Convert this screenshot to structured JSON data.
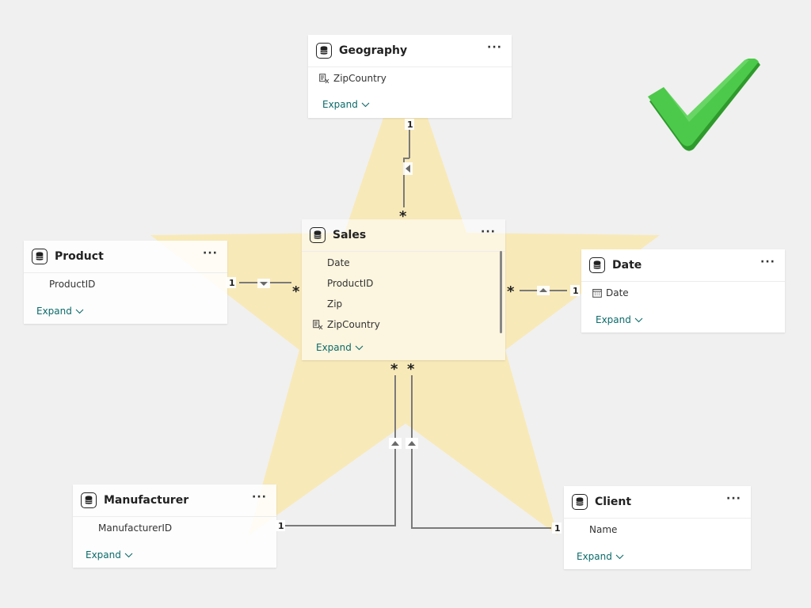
{
  "colors": {
    "accent": "#0b6a6a",
    "star_fill": "#fbe7a6",
    "check_green": "#3cb83a",
    "line_gray": "#7a7a7a"
  },
  "icons": {
    "table": "database-table-icon",
    "hierarchy": "geography-field-icon",
    "calendar": "calendar-icon",
    "more": "more-options-icon",
    "chevron": "chevron-down-icon",
    "check": "checkmark-icon",
    "filter_arrow": "filter-direction-icon"
  },
  "tables": {
    "geography": {
      "title": "Geography",
      "fields": [
        "ZipCountry"
      ],
      "expand": "Expand",
      "more": "···"
    },
    "sales": {
      "title": "Sales",
      "fields": [
        "Date",
        "ProductID",
        "Zip",
        "ZipCountry"
      ],
      "expand": "Expand",
      "more": "···"
    },
    "product": {
      "title": "Product",
      "fields": [
        "ProductID"
      ],
      "expand": "Expand",
      "more": "···"
    },
    "date": {
      "title": "Date",
      "fields": [
        "Date"
      ],
      "expand": "Expand",
      "more": "···"
    },
    "manufacturer": {
      "title": "Manufacturer",
      "fields": [
        "ManufacturerID"
      ],
      "expand": "Expand",
      "more": "···"
    },
    "client": {
      "title": "Client",
      "fields": [
        "Name"
      ],
      "expand": "Expand",
      "more": "···"
    }
  },
  "relationships": [
    {
      "from": "Geography",
      "to": "Sales",
      "one_label": "1",
      "many_label": "*"
    },
    {
      "from": "Product",
      "to": "Sales",
      "one_label": "1",
      "many_label": "*"
    },
    {
      "from": "Date",
      "to": "Sales",
      "one_label": "1",
      "many_label": "*"
    },
    {
      "from": "Manufacturer",
      "to": "Sales",
      "one_label": "1",
      "many_label": "*"
    },
    {
      "from": "Client",
      "to": "Sales",
      "one_label": "1",
      "many_label": "*"
    }
  ]
}
